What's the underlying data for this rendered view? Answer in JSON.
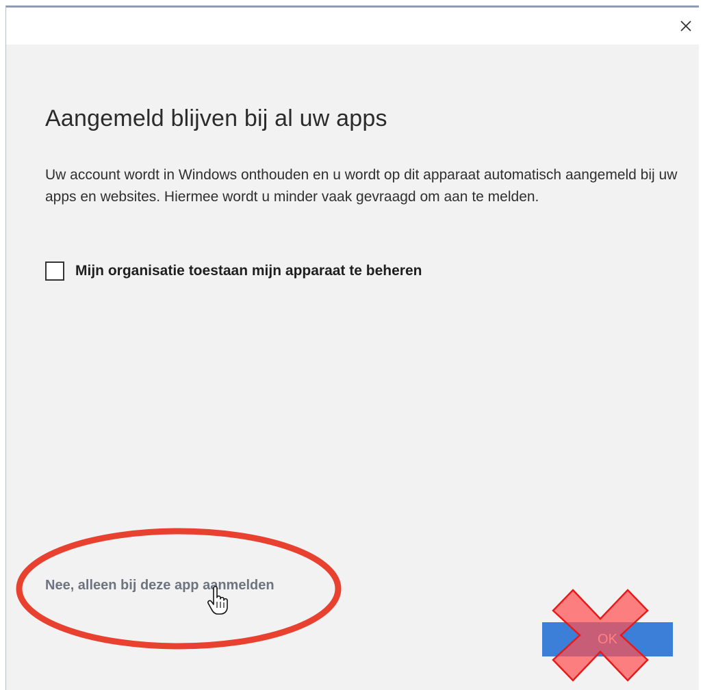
{
  "dialog": {
    "close_icon": "close-icon",
    "title": "Aangemeld blijven bij al uw apps",
    "description": "Uw account wordt in Windows onthouden en u wordt op dit apparaat automatisch aangemeld bij uw apps en websites. Hiermee wordt u minder vaak gevraagd om aan te melden.",
    "checkbox": {
      "label": "Mijn organisatie toestaan mijn apparaat te beheren",
      "checked": false
    },
    "alt_link_label": "Nee, alleen bij deze app aanmelden",
    "ok_label": "OK"
  },
  "annotations": {
    "ellipse_color": "#e8412f",
    "cross_color": "#ff5c5c",
    "cursor_icon": "hand-pointer-icon"
  },
  "colors": {
    "accent": "#3b7fd9",
    "background": "#f2f2f2"
  }
}
